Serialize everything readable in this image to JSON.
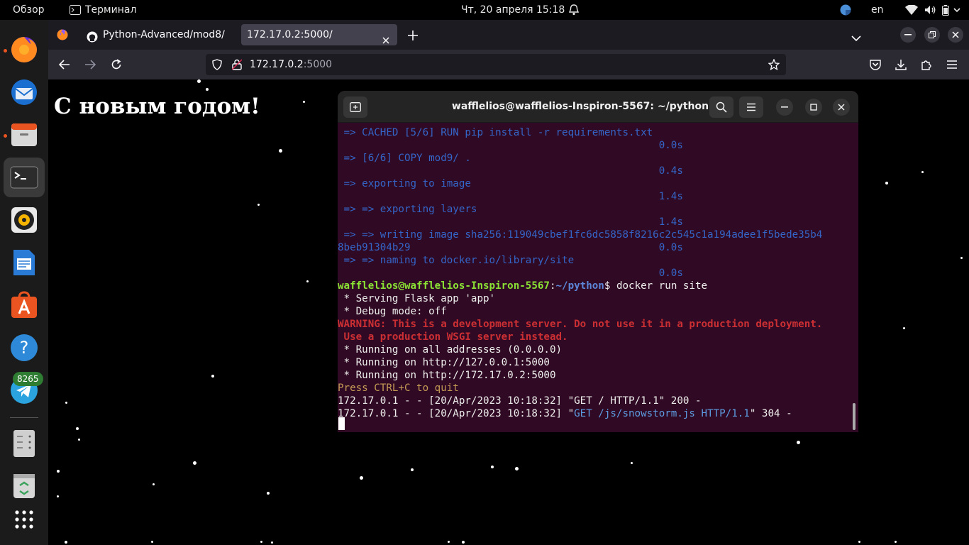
{
  "topbar": {
    "overview_label": "Обзор",
    "app_label": "Терминал",
    "datetime": "Чт, 20 апреля  15:18",
    "lang": "en"
  },
  "dock": {
    "telegram_badge": "8265"
  },
  "browser": {
    "tabs": [
      {
        "label": "Python-Advanced/mod8/"
      },
      {
        "label": "172.17.0.2:5000/"
      }
    ],
    "url_host": "172.17.0.2",
    "url_rest": ":5000"
  },
  "page": {
    "greeting": "С новым годом!"
  },
  "terminal": {
    "title": "wafflelios@wafflelios-Inspiron-5567: ~/python",
    "lines": {
      "l1": " => CACHED [5/6] RUN pip install -r requirements.txt",
      "l2": "                                                     0.0s",
      "l3": " => [6/6] COPY mod9/ .",
      "l4": "                                                     0.4s",
      "l5": " => exporting to image",
      "l6": "                                                     1.4s",
      "l7": " => => exporting layers",
      "l8": "                                                     1.4s",
      "l9": " => => writing image sha256:119049cbef1fc6dc5858f8216c2c545c1a194adee1f5bede35b4",
      "l10": "8beb91304b29                                         0.0s",
      "l11": " => => naming to docker.io/library/site",
      "l12": "                                                     0.0s",
      "prompt_user": "wafflelios@wafflelios-Inspiron-5567",
      "prompt_sep": ":",
      "prompt_path": "~/python",
      "prompt_cmd": "$ docker run site",
      "l14": " * Serving Flask app 'app'",
      "l15": " * Debug mode: off",
      "l16": "WARNING: This is a development server. Do not use it in a production deployment.",
      "l17": " Use a production WSGI server instead.",
      "l18": " * Running on all addresses (0.0.0.0)",
      "l19": " * Running on http://127.0.0.1:5000",
      "l20": " * Running on http://172.17.0.2:5000",
      "l21": "Press CTRL+C to quit",
      "l22": "172.17.0.1 - - [20/Apr/2023 10:18:32] \"GET / HTTP/1.1\" 200 -",
      "l23a": "172.17.0.1 - - [20/Apr/2023 10:18:32] \"",
      "l23b": "GET /js/snowstorm.js HTTP/1.1",
      "l23c": "\" 304 -"
    }
  }
}
